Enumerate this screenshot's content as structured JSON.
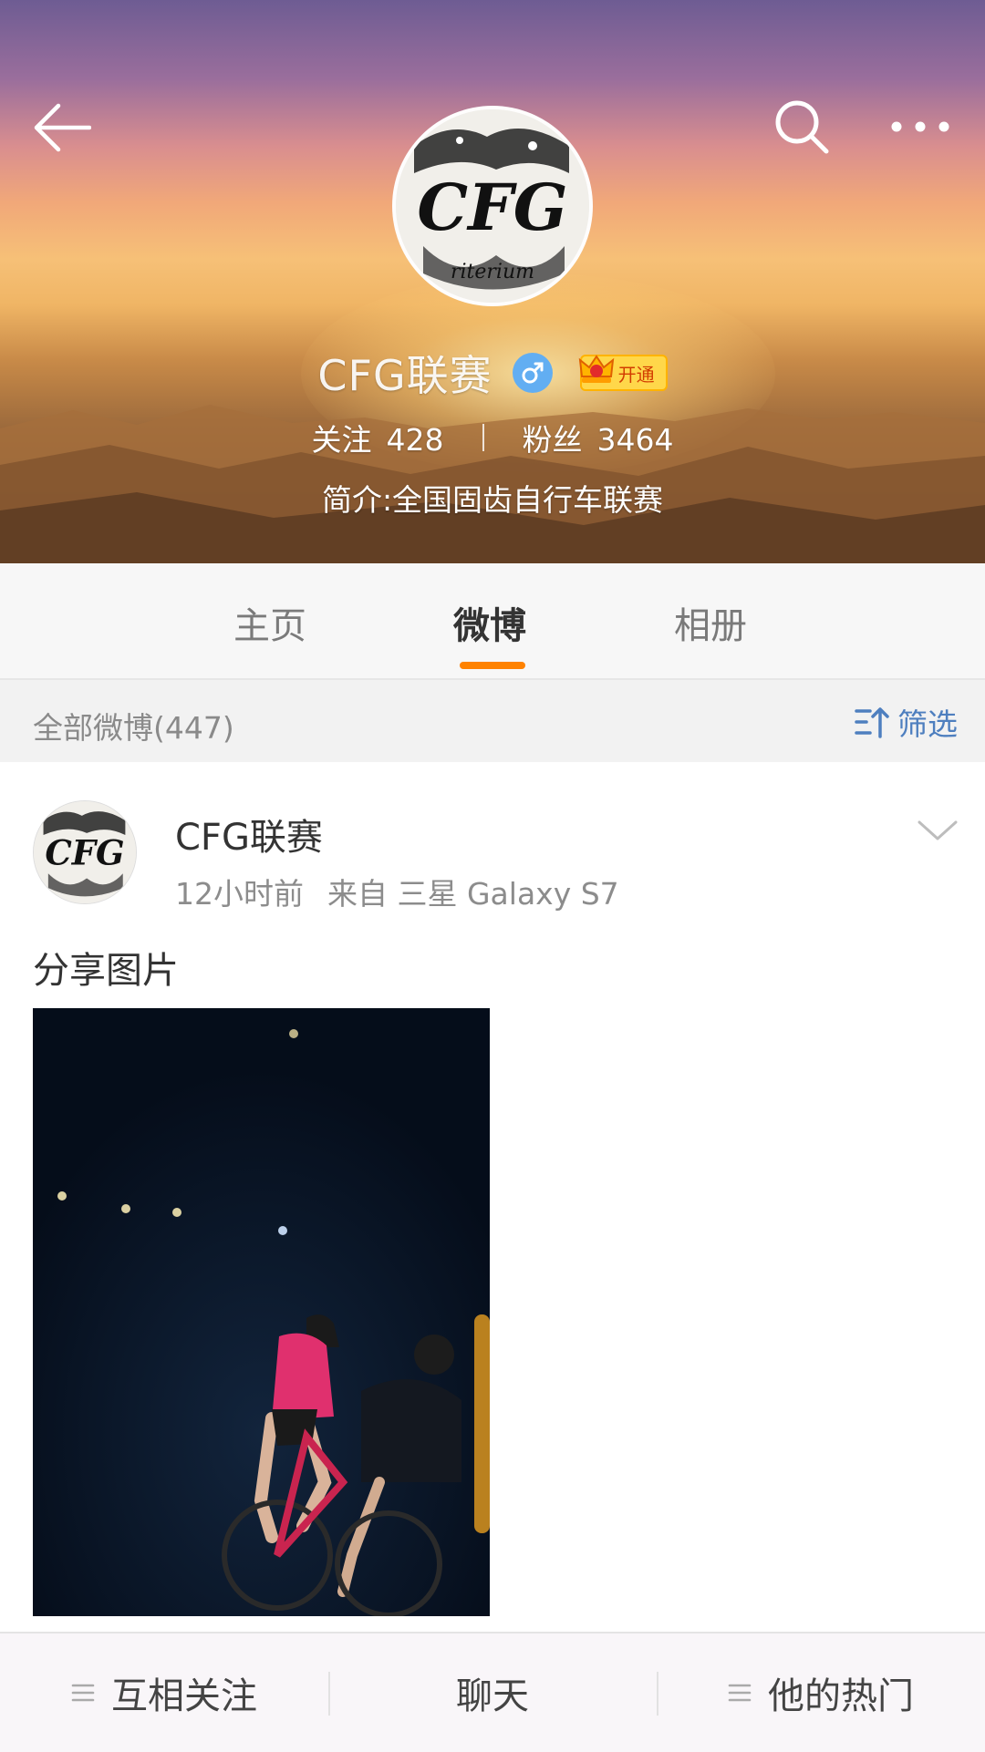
{
  "header": {
    "back_icon": "back-arrow-icon",
    "search_icon": "search-icon",
    "more_icon": "more-dots-icon"
  },
  "profile": {
    "name": "CFG联赛",
    "gender_icon": "male-icon",
    "vip_label": "开通",
    "following_label": "关注",
    "following_count": "428",
    "followers_label": "粉丝",
    "followers_count": "3464",
    "bio": "简介:全国固齿自行车联赛"
  },
  "tabs": [
    {
      "label": "主页",
      "active": false
    },
    {
      "label": "微博",
      "active": true
    },
    {
      "label": "相册",
      "active": false
    }
  ],
  "accent_color": "#ff8200",
  "filter_bar": {
    "all_posts": "全部微博(447)",
    "filter_label": "筛选",
    "filter_icon": "sort-filter-icon"
  },
  "post": {
    "author": "CFG联赛",
    "time": "12小时前",
    "source": "来自 三星 Galaxy S7",
    "text": "分享图片",
    "menu_icon": "chevron-down-icon",
    "image": "night-cycling-race-photo"
  },
  "bottom_bar": {
    "items": [
      {
        "label": "互相关注",
        "icon": "menu-lines-icon"
      },
      {
        "label": "聊天",
        "icon": ""
      },
      {
        "label": "他的热门",
        "icon": "menu-lines-icon"
      }
    ]
  }
}
